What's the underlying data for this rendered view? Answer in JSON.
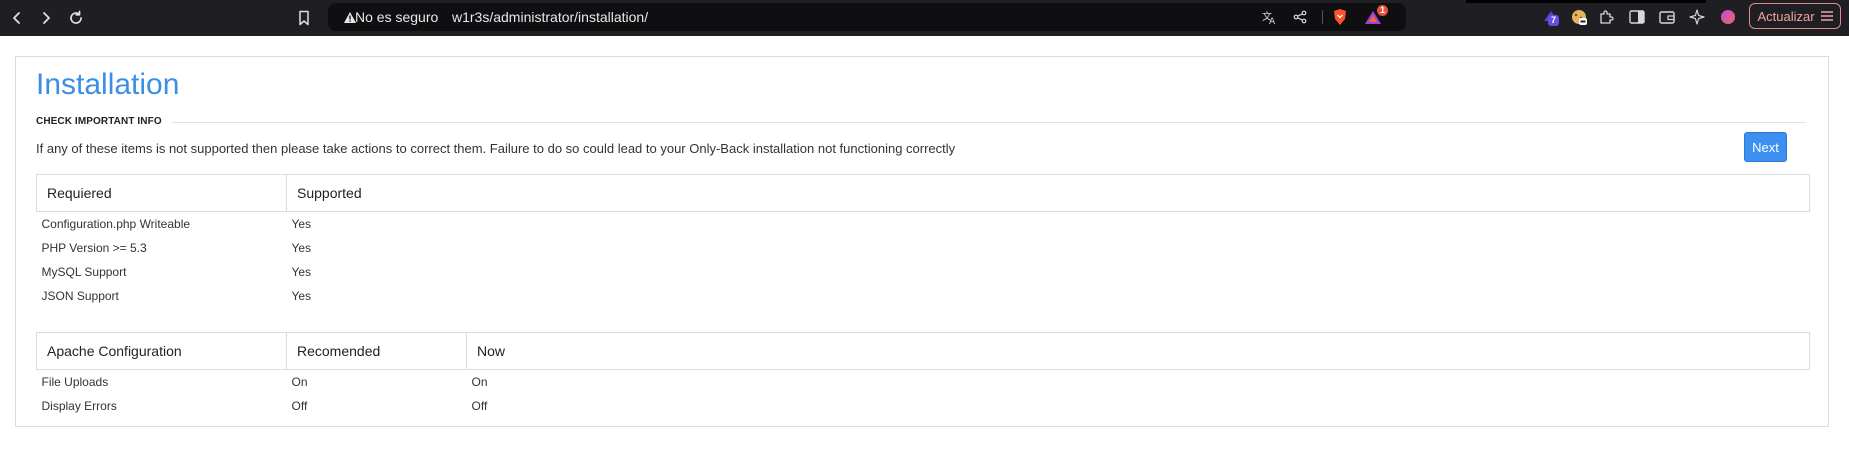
{
  "browser": {
    "security_label": "No es seguro",
    "url": "w1r3s/administrator/installation/",
    "notification_count": "1",
    "extensions_count": "7",
    "update_label": "Actualizar",
    "icons": {
      "back": "chevron-left-icon",
      "forward": "chevron-right-icon",
      "reload": "reload-icon",
      "bookmark": "bookmark-icon",
      "warning": "warning-icon",
      "translate": "translate-icon",
      "share": "share-icon",
      "brave": "brave-shield-icon",
      "rewards": "brave-rewards-icon",
      "wallet": "wallet-icon",
      "sidebar": "sidebar-icon",
      "extensions": "puzzle-icon",
      "leo": "leo-ai-icon",
      "profile": "profile-avatar-icon",
      "menu": "hamburger-icon"
    },
    "colors": {
      "chrome_bg": "#1f1f23",
      "urlbar_bg": "#0f0f12",
      "update_border": "#e08a86"
    }
  },
  "page": {
    "title": "Installation",
    "section_title": "CHECK IMPORTANT INFO",
    "info_text": "If any of these items is not supported then please take actions to correct them. Failure to do so could lead to your Only-Back installation not functioning correctly",
    "next_label": "Next",
    "colors": {
      "title": "#3a8ee6",
      "ok": "#3c9a22",
      "button": "#3d8ff2"
    }
  },
  "requirements": {
    "headers": [
      "Requiered",
      "Supported"
    ],
    "rows": [
      {
        "name": "Configuration.php Writeable",
        "value": "Yes"
      },
      {
        "name": "PHP Version >= 5.3",
        "value": "Yes"
      },
      {
        "name": "MySQL Support",
        "value": "Yes"
      },
      {
        "name": "JSON Support",
        "value": "Yes"
      }
    ]
  },
  "apache": {
    "headers": [
      "Apache Configuration",
      "Recomended",
      "Now"
    ],
    "rows": [
      {
        "name": "File Uploads",
        "recommended": "On",
        "now": "On"
      },
      {
        "name": "Display Errors",
        "recommended": "Off",
        "now": "Off"
      }
    ]
  }
}
